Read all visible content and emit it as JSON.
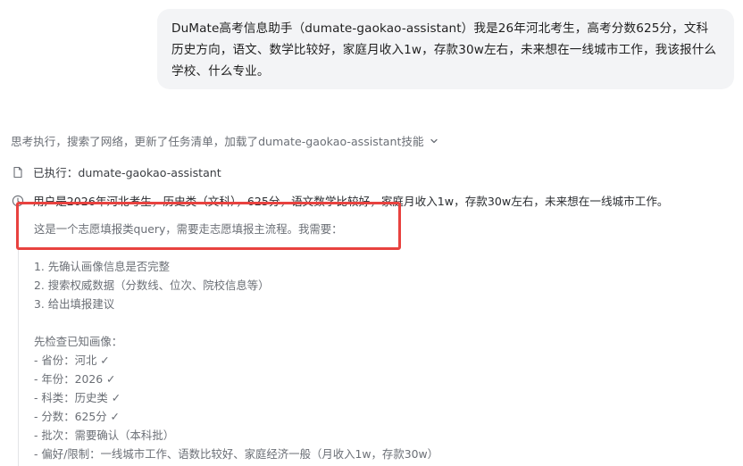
{
  "user_message": {
    "text": "DuMate高考信息助手（dumate-gaokao-assistant）我是26年河北考生，高考分数625分，文科历史方向，语文、数学比较好，家庭月收入1w，存款30w左右，未来想在一线城市工作，我该报什么学校、什么专业。"
  },
  "assistant": {
    "thinking_summary": "思考执行，搜索了网络，更新了任务清单，加载了dumate-gaokao-assistant技能",
    "thinking_toggle_icon": "chevron-down-icon",
    "executed_step": {
      "icon": "document-icon",
      "label": "已执行：dumate-gaokao-assistant"
    },
    "thinking_step": {
      "icon": "clock-icon",
      "label": "用户是2026年河北考生，历史类（文科），625分，语文数学比较好，家庭月收入1w，存款30w左右，未来想在一线城市工作。"
    },
    "thought_lines": [
      "这是一个志愿填报类query，需要走志愿填报主流程。我需要：",
      "",
      "1. 先确认画像信息是否完整",
      "2. 搜索权威数据（分数线、位次、院校信息等）",
      "3. 给出填报建议",
      "",
      "先检查已知画像：",
      "- 省份：河北 ✓",
      "- 年份：2026 ✓",
      "- 科类：历史类 ✓",
      "- 分数：625分 ✓",
      "- 批次：需要确认（本科批）",
      "- 偏好/限制：一线城市工作、语数比较好、家庭经济一般（月收入1w，存款30w）"
    ]
  },
  "colors": {
    "highlight_border": "#e8423f",
    "bubble_bg": "#f3f4f6",
    "muted_text": "#6b6f76"
  }
}
